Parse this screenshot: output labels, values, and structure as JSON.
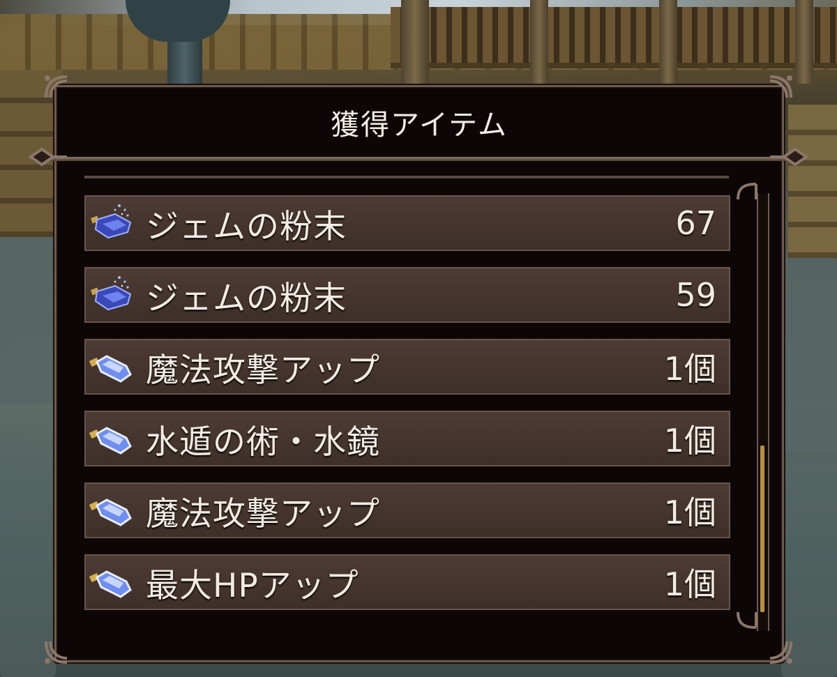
{
  "window": {
    "title": "獲得アイテム"
  },
  "items": [
    {
      "name": "ジェムの粉末",
      "quantity": "67",
      "icon": "gem-powder-icon"
    },
    {
      "name": "ジェムの粉末",
      "quantity": "59",
      "icon": "gem-powder-icon"
    },
    {
      "name": "魔法攻撃アップ",
      "quantity": "1個",
      "icon": "crystal-item-icon"
    },
    {
      "name": "水遁の術・水鏡",
      "quantity": "1個",
      "icon": "crystal-item-icon"
    },
    {
      "name": "魔法攻撃アップ",
      "quantity": "1個",
      "icon": "crystal-item-icon"
    },
    {
      "name": "最大HPアップ",
      "quantity": "1個",
      "icon": "crystal-item-icon"
    }
  ],
  "scrollbar": {
    "position_fraction": 0.93,
    "visible_fraction": 0.38
  },
  "colors": {
    "panel_bg": "#0c0706",
    "row_bg": "#4d3b34",
    "border": "#6e5a50",
    "text": "#f3ece4",
    "scroll_thumb": "#b89040"
  }
}
